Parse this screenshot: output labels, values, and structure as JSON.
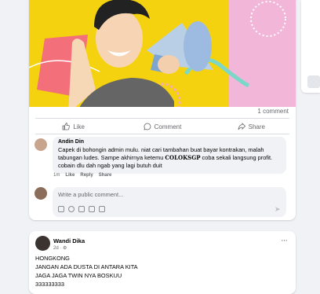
{
  "post": {
    "comment_count": "1 comment",
    "actions": {
      "like": "Like",
      "comment": "Comment",
      "share": "Share"
    }
  },
  "comment": {
    "author": "Andin Din",
    "text_before": "Capek di bohongin admin mulu. niat cari tambahan buat bayar kontrakan, malah tabungan ludes. Sampe akhirnya ketemu ",
    "text_brand": "COLOKSGP",
    "text_after": " coba sekali langsung profit. cobain dlu dah ngab yang lagi butuh duit",
    "time": "1m",
    "like": "Like",
    "reply": "Reply",
    "share": "Share"
  },
  "reply_box": {
    "placeholder": "Write a public comment..."
  },
  "post2": {
    "author": "Wandi Dika",
    "time": "2d · ⚙",
    "more": "···",
    "lines": [
      "HONGKONG",
      "JANGAN ADA DUSTA DI ANTARA KITA",
      "JAGA JAGA TWIN NYA BOSKUU",
      "333333333"
    ]
  }
}
